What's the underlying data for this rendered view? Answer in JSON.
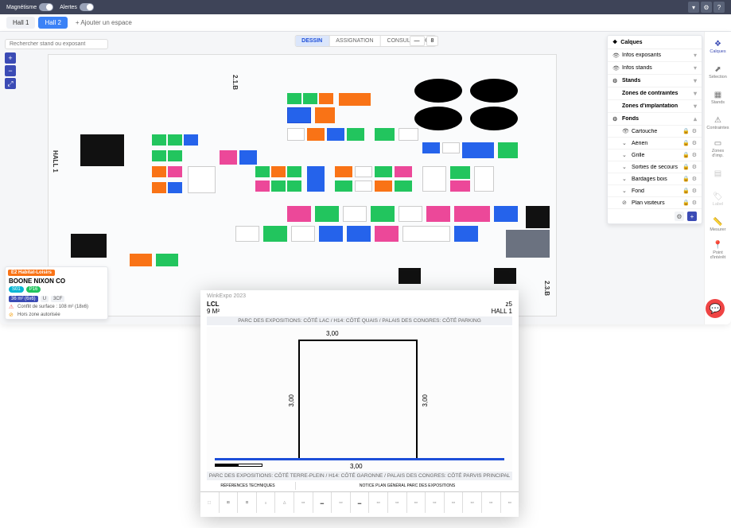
{
  "topbar": {
    "magnetisme": "Magnétisme",
    "alertes": "Alertes"
  },
  "tabs": {
    "hall1": "Hall 1",
    "hall2": "Hall 2",
    "add": "+ Ajouter un espace",
    "search_placeholder": "Rechercher stand ou exposant"
  },
  "modes": {
    "dessin": "DESSIN",
    "assignation": "ASSIGNATION",
    "consultation": "CONSULTATION",
    "info1": "—",
    "info2": "8"
  },
  "rail": {
    "calques": "Calques",
    "selection": "Sélection",
    "stands": "Stands",
    "contraintes": "Contraintes",
    "zones": "Zones d'imp.",
    "nomenclature": "",
    "label": "Label",
    "mesurer": "Mesurer",
    "poi": "Point d'intérêt"
  },
  "layers": {
    "title": "Calques",
    "groups": [
      {
        "label": "Infos exposants",
        "icon": "👁"
      },
      {
        "label": "Infos stands",
        "icon": "👁"
      },
      {
        "label": "Stands",
        "icon": "⚙"
      },
      {
        "label": "Zones de contraintes",
        "icon": ""
      },
      {
        "label": "Zones d'implantation",
        "icon": ""
      },
      {
        "label": "Fonds",
        "icon": "⚙"
      }
    ],
    "subs": [
      {
        "label": "Cartouche"
      },
      {
        "label": "Aérien"
      },
      {
        "label": "Grille"
      },
      {
        "label": "Sorties de secours"
      },
      {
        "label": "Bardages bois"
      },
      {
        "label": "Fond"
      },
      {
        "label": "Plan visiteurs"
      }
    ]
  },
  "info": {
    "tag_prefix": "E2",
    "tag": "Habitat-Loisirs",
    "title": "BOONE NIXON CO",
    "chip1": "S01",
    "chip2": "P16",
    "badge1": "36 m² (6x6)",
    "badge2": "U",
    "badge3": "3CF",
    "line1_icon": "⚠",
    "line1": "Conflit de surface : 108 m² (18x6)",
    "line2_icon": "⊘",
    "line2": "Hors zone autorisée"
  },
  "halls": {
    "h1": "HALL 1",
    "h21b": "2.1.B",
    "h23b": "2.3.B"
  },
  "doc": {
    "event": "WinkExpo 2023",
    "code": "LCL",
    "area": "9 M²",
    "zone": "z5",
    "hall": "HALL 1",
    "loc_top": "PARC DES EXPOSITIONS: CÔTÉ LAC / H14: CÔTÉ QUAIS / PALAIS DES CONGRES: CÔTÉ PARKING",
    "loc_bottom": "PARC DES EXPOSITIONS: CÔTÉ TERRE-PLEIN / H14: CÔTÉ GARONNE / PALAIS DES CONGRES: CÔTÉ PARVIS PRINCIPAL",
    "dim": "3,00",
    "legend_title_left": "RÉFÉRENCES TECHNIQUES",
    "legend_title_right": "NOTICE PLAN GÉNÉRAL PARC DES EXPOSITIONS"
  }
}
